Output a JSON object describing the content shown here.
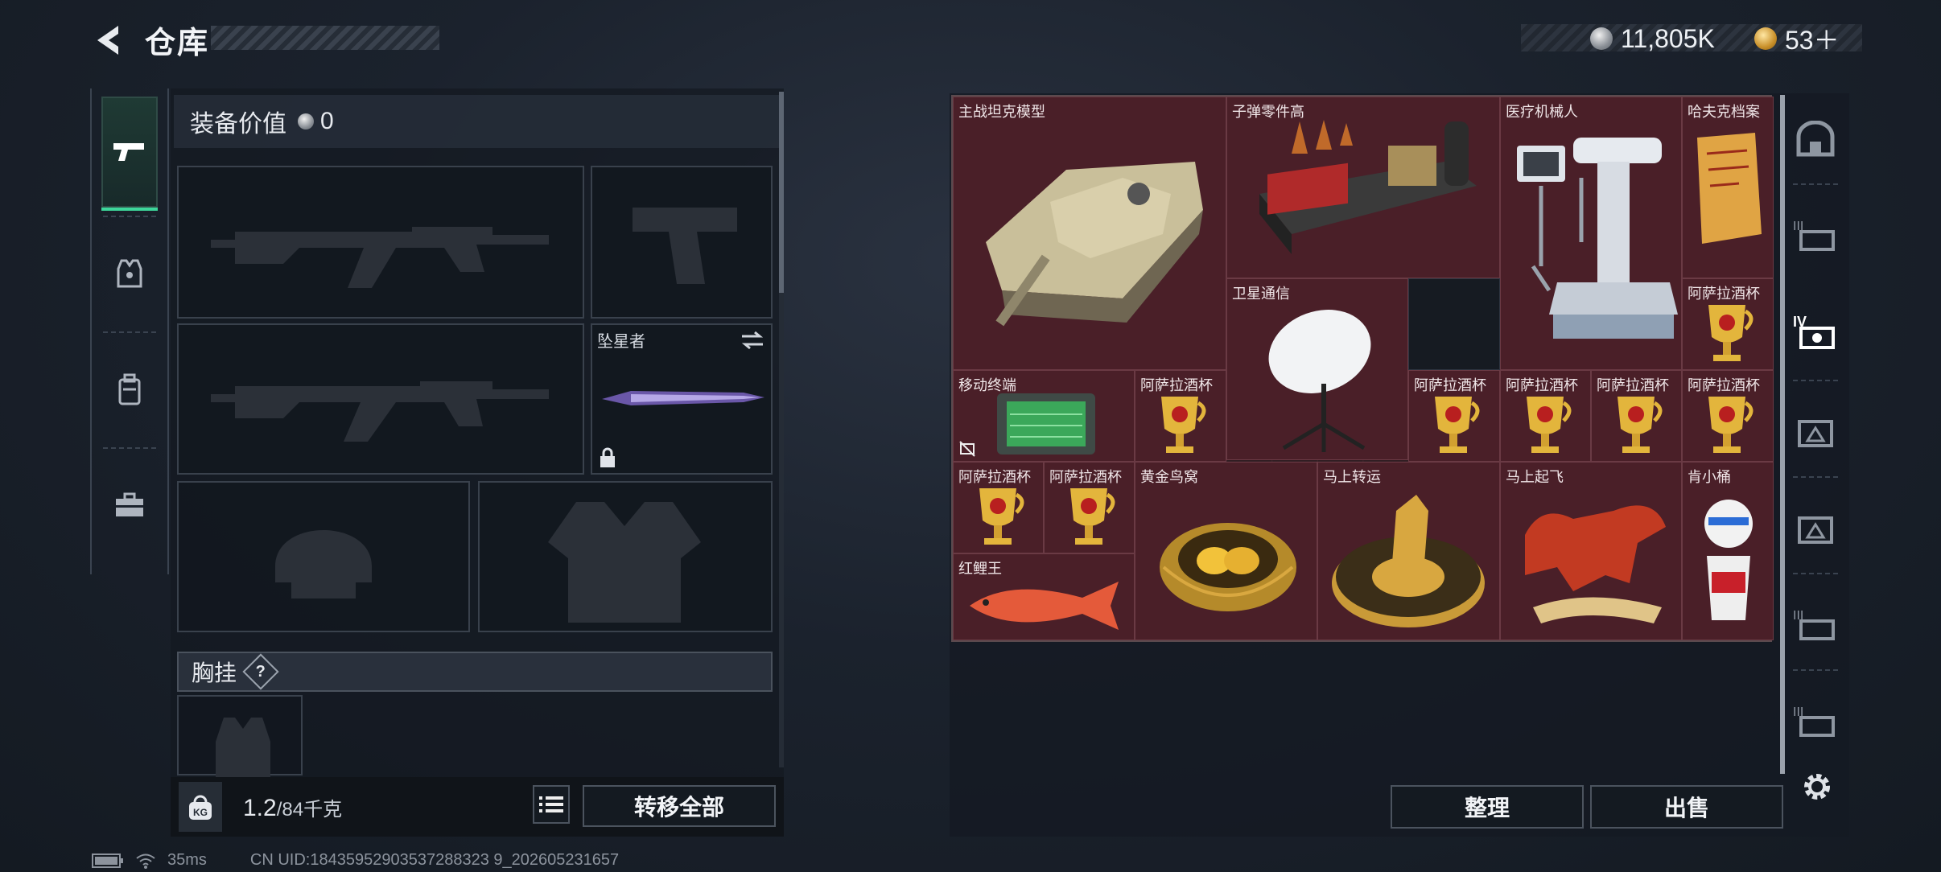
{
  "header": {
    "title": "仓库"
  },
  "currency": {
    "silver": "11,805K",
    "gold": "53＋"
  },
  "left_nav": [
    {
      "name": "weapons",
      "icon": "pistol-icon"
    },
    {
      "name": "armor",
      "icon": "vest-icon"
    },
    {
      "name": "backpack",
      "icon": "backpack-icon"
    },
    {
      "name": "case",
      "icon": "briefcase-icon"
    }
  ],
  "loadout": {
    "value_label": "装备价值",
    "value": "0",
    "melee_slot_label": "坠星者",
    "vest_label": "胸挂",
    "help": "?",
    "weight_current": "1.2",
    "weight_max": "/84千克",
    "kg_icon_label": "KG",
    "transfer_all": "转移全部"
  },
  "stash": {
    "items": [
      {
        "name": "主战坦克模型"
      },
      {
        "name": "子弹零件高"
      },
      {
        "name": "医疗机械人"
      },
      {
        "name": "哈夫克档案"
      },
      {
        "name": "卫星通信"
      },
      {
        "name": "阿萨拉酒杯"
      },
      {
        "name": "移动终端"
      },
      {
        "name": "阿萨拉酒杯"
      },
      {
        "name": "阿萨拉酒杯"
      },
      {
        "name": "阿萨拉酒杯"
      },
      {
        "name": "阿萨拉酒杯"
      },
      {
        "name": "阿萨拉酒杯"
      },
      {
        "name": "阿萨拉酒杯"
      },
      {
        "name": "阿萨拉酒杯"
      },
      {
        "name": "黄金鸟窝"
      },
      {
        "name": "马上转运"
      },
      {
        "name": "马上起飞"
      },
      {
        "name": "肯小桶"
      },
      {
        "name": "红鲤王"
      }
    ],
    "sort_button": "整理",
    "sell_button": "出售"
  },
  "footer": {
    "ping": "35ms",
    "uid": "CN UID:18435952903537288323 9_202605231657"
  }
}
